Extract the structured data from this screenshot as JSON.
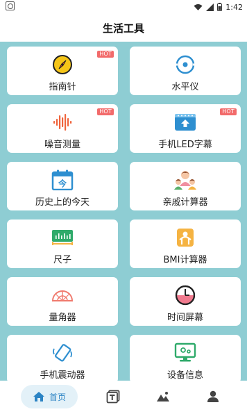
{
  "status_bar": {
    "time": "1:42"
  },
  "header": {
    "title": "生活工具"
  },
  "hot_badge": "HOT",
  "tools": [
    {
      "label": "指南针",
      "icon": "compass-icon",
      "hot": true
    },
    {
      "label": "水平仪",
      "icon": "level-icon",
      "hot": false
    },
    {
      "label": "噪音测量",
      "icon": "sound-wave-icon",
      "hot": true
    },
    {
      "label": "手机LED字幕",
      "icon": "led-subtitle-icon",
      "hot": true
    },
    {
      "label": "历史上的今天",
      "icon": "calendar-today-icon",
      "hot": false
    },
    {
      "label": "亲戚计算器",
      "icon": "family-icon",
      "hot": false
    },
    {
      "label": "尺子",
      "icon": "ruler-icon",
      "hot": false
    },
    {
      "label": "BMI计算器",
      "icon": "bmi-scale-icon",
      "hot": false
    },
    {
      "label": "量角器",
      "icon": "protractor-icon",
      "hot": false
    },
    {
      "label": "时间屏幕",
      "icon": "clock-icon",
      "hot": false
    },
    {
      "label": "手机震动器",
      "icon": "phone-vibrate-icon",
      "hot": false
    },
    {
      "label": "设备信息",
      "icon": "device-info-icon",
      "hot": false
    }
  ],
  "calendar_icon_text": "今",
  "bottom_nav": {
    "home_label": "首页",
    "items": [
      "home-icon",
      "tools-icon",
      "photo-icon",
      "user-icon"
    ]
  },
  "colors": {
    "background": "#8ecdd3",
    "hot_badge": "#f26b6b",
    "nav_active": "#2c84c4"
  }
}
